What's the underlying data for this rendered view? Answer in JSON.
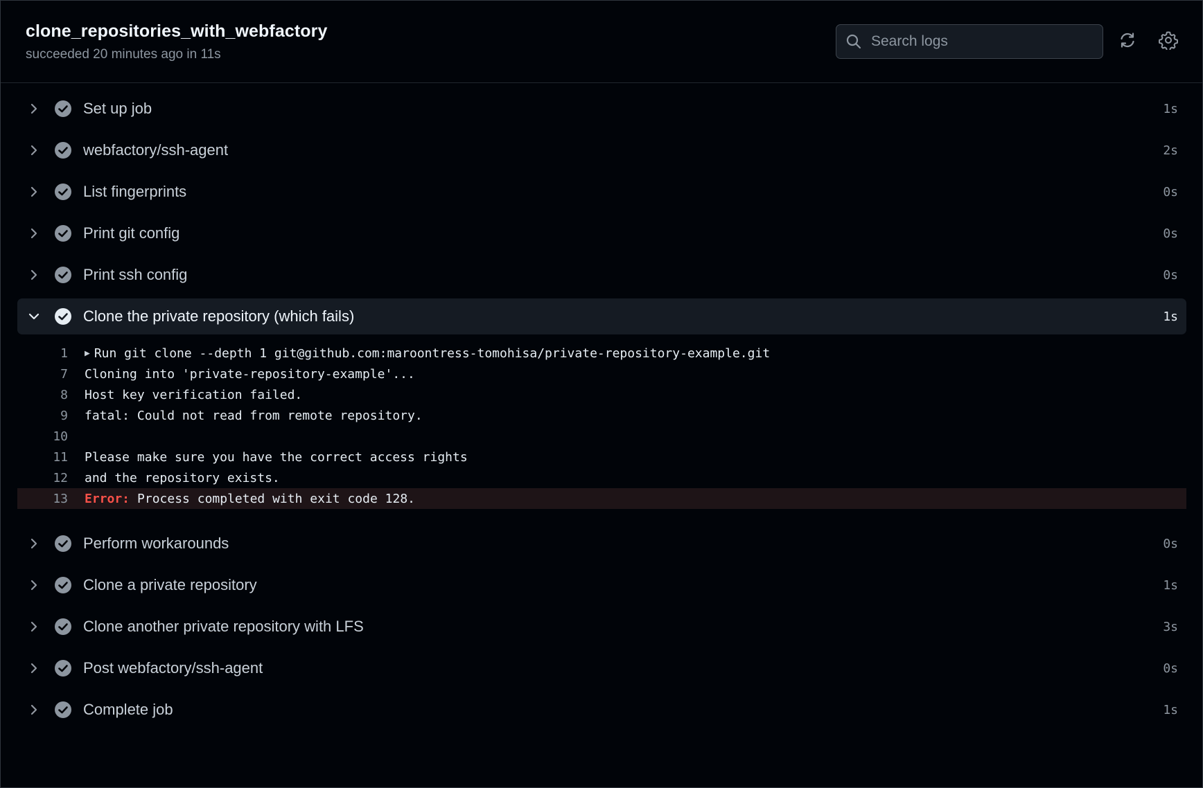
{
  "job": {
    "title": "clone_repositories_with_webfactory",
    "subtitle": "succeeded 20 minutes ago in 11s"
  },
  "search": {
    "placeholder": "Search logs"
  },
  "colors": {
    "background": "#010409",
    "expanded_row": "#151b23",
    "error_row": "#1e1417",
    "error_text": "#f85149",
    "muted_text": "#8d96a0"
  },
  "icons": {
    "search": "search-icon",
    "refresh": "refresh-icon",
    "settings": "gear-icon",
    "collapsed": "chevron-right-icon",
    "expanded": "chevron-down-icon",
    "status": "check-circle-icon"
  },
  "steps_before": [
    {
      "name": "Set up job",
      "duration": "1s"
    },
    {
      "name": "webfactory/ssh-agent",
      "duration": "2s"
    },
    {
      "name": "List fingerprints",
      "duration": "0s"
    },
    {
      "name": "Print git config",
      "duration": "0s"
    },
    {
      "name": "Print ssh config",
      "duration": "0s"
    }
  ],
  "expanded_step": {
    "name": "Clone the private repository (which fails)",
    "duration": "1s",
    "log": [
      {
        "line": "1",
        "text": "Run git clone --depth 1 git@github.com:maroontress-tomohisa/private-repository-example.git",
        "collapsible": true
      },
      {
        "line": "7",
        "text": "Cloning into 'private-repository-example'..."
      },
      {
        "line": "8",
        "text": "Host key verification failed."
      },
      {
        "line": "9",
        "text": "fatal: Could not read from remote repository."
      },
      {
        "line": "10",
        "text": ""
      },
      {
        "line": "11",
        "text": "Please make sure you have the correct access rights"
      },
      {
        "line": "12",
        "text": "and the repository exists."
      },
      {
        "line": "13",
        "error_label": "Error:",
        "text": "Process completed with exit code 128.",
        "error": true
      }
    ]
  },
  "steps_after": [
    {
      "name": "Perform workarounds",
      "duration": "0s"
    },
    {
      "name": "Clone a private repository",
      "duration": "1s"
    },
    {
      "name": "Clone another private repository with LFS",
      "duration": "3s"
    },
    {
      "name": "Post webfactory/ssh-agent",
      "duration": "0s"
    },
    {
      "name": "Complete job",
      "duration": "1s"
    }
  ]
}
